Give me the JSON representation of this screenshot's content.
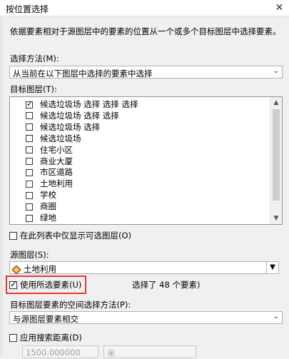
{
  "window": {
    "title": "按位置选择",
    "close_glyph": "✕"
  },
  "description": "依据要素相对于源图层中的要素的位置从一个或多个目标图层中选择要素。",
  "selection_method": {
    "label": "选择方法(M):",
    "value": "从当前在以下图层中选择的要素中选择"
  },
  "target_layers": {
    "label": "目标图层(T):",
    "items": [
      {
        "label": "候选垃圾场 选择 选择 选择",
        "checked": true
      },
      {
        "label": "候选垃圾场 选择 选择",
        "checked": false
      },
      {
        "label": "候选垃圾场 选择",
        "checked": false
      },
      {
        "label": "候选垃圾场",
        "checked": false
      },
      {
        "label": "住宅小区",
        "checked": false
      },
      {
        "label": "商业大厦",
        "checked": false
      },
      {
        "label": "市区道路",
        "checked": false
      },
      {
        "label": "土地利用",
        "checked": false
      },
      {
        "label": "学校",
        "checked": false
      },
      {
        "label": "商圈",
        "checked": false
      },
      {
        "label": "绿地",
        "checked": false
      }
    ]
  },
  "only_selectable": {
    "label": "在此列表中仅显示可选图层(O)",
    "checked": false
  },
  "source_layer": {
    "label": "源图层(S):",
    "value": "土地利用"
  },
  "use_selected": {
    "label": "使用所选要素(U)",
    "checked": true
  },
  "selected_count_text": "选择了 48 个要素)",
  "spatial_method": {
    "label": "目标图层要素的空间选择方法(P):",
    "value": "与源图层要素相交"
  },
  "search_distance": {
    "label": "应用搜索距离(D)",
    "checked": false,
    "value": "1500.000000",
    "unit": "米"
  },
  "colors": {
    "highlight_box": "#e53935",
    "layer_icon_fill": "#f0a030"
  }
}
